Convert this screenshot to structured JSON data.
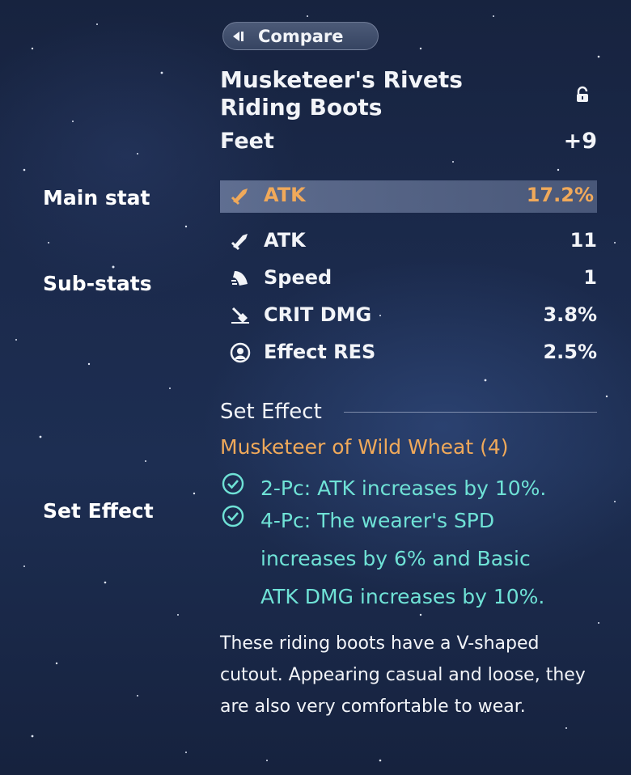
{
  "compare": {
    "label": "Compare",
    "icon": "back-triangle-icon"
  },
  "relic": {
    "name_line1": "Musketeer's Rivets",
    "name_line2": "Riding Boots",
    "slot": "Feet",
    "level": "+9",
    "lock_icon": "lock-icon"
  },
  "labels": {
    "main_stat": "Main stat",
    "sub_stats": "Sub-stats",
    "set_effect": "Set Effect"
  },
  "main_stat": {
    "name": "ATK",
    "value": "17.2%",
    "icon": "sword-icon"
  },
  "sub_stats": [
    {
      "name": "ATK",
      "value": "11",
      "icon": "sword-icon"
    },
    {
      "name": "Speed",
      "value": "1",
      "icon": "boot-speed-icon"
    },
    {
      "name": "CRIT DMG",
      "value": "3.8%",
      "icon": "crit-dmg-icon"
    },
    {
      "name": "Effect RES",
      "value": "2.5%",
      "icon": "effect-res-icon"
    }
  ],
  "set_effect": {
    "header": "Set Effect",
    "set_name": "Musketeer of Wild Wheat (4)",
    "bonus_2pc": "2-Pc: ATK increases by 10%.",
    "bonus_4pc_line1": "4-Pc: The wearer's SPD",
    "bonus_4pc_line2": "increases by 6% and Basic",
    "bonus_4pc_line3": "ATK DMG increases by 10%."
  },
  "description": "These riding boots have a V-shaped cutout. Appearing casual and loose, they are also very comfortable to wear.",
  "colors": {
    "accent_orange": "#f0a95a",
    "set_bonus_teal": "#6fe2d6",
    "background": "#1b2a4c"
  }
}
